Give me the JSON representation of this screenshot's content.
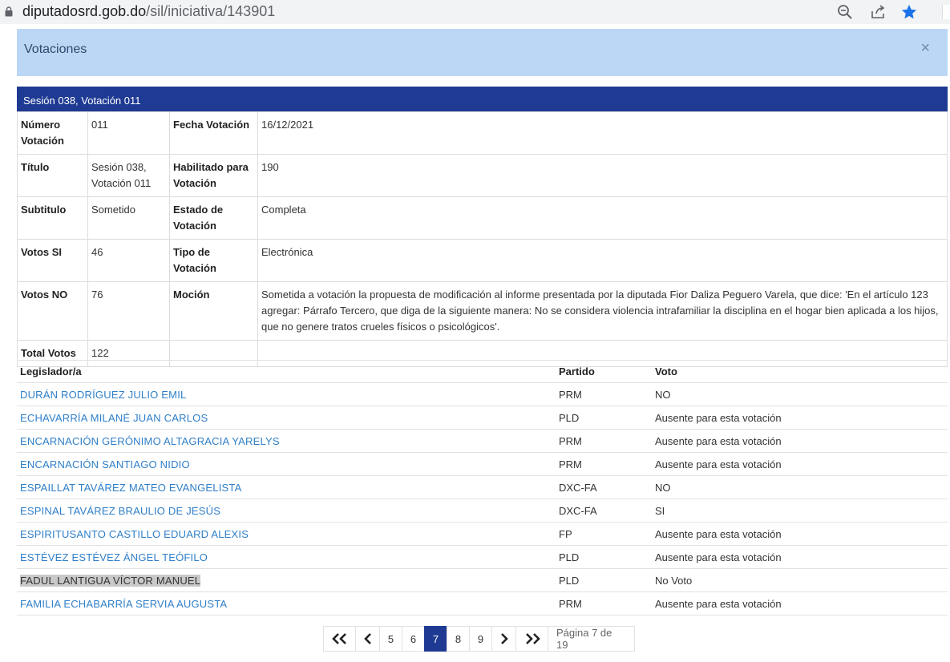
{
  "browser": {
    "url_host": "diputadosrd.gob.do",
    "url_path": "/sil/iniciativa/143901"
  },
  "modal": {
    "title": "Votaciones",
    "close_label": "×"
  },
  "session": {
    "title": "Sesión 038, Votación 011"
  },
  "details": {
    "numero_votacion_label": "Número Votación",
    "numero_votacion": "011",
    "fecha_votacion_label": "Fecha Votación",
    "fecha_votacion": "16/12/2021",
    "titulo_label": "Título",
    "titulo": "Sesión 038, Votación 011",
    "habilitado_label": "Habilitado para Votación",
    "habilitado": "190",
    "subtitulo_label": "Subtitulo",
    "subtitulo": "Sometido",
    "estado_label": "Estado de Votación",
    "estado": "Completa",
    "votos_si_label": "Votos SI",
    "votos_si": "46",
    "tipo_label": "Tipo de Votación",
    "tipo": "Electrónica",
    "votos_no_label": "Votos NO",
    "votos_no": "76",
    "mocion_label": "Moción",
    "mocion": "Sometida a votación la propuesta de modificación al informe presentada por la diputada Fior Daliza Peguero Varela, que dice: 'En el artículo 123 agregar: Párrafo Tercero, que diga de la siguiente manera: No se considera violencia intrafamiliar la disciplina en el hogar bien aplicada a los hijos, que no genere tratos crueles físicos o psicológicos'.",
    "total_votos_label": "Total Votos",
    "total_votos": "122"
  },
  "votes": {
    "headers": {
      "legislador": "Legislador/a",
      "partido": "Partido",
      "voto": "Voto"
    },
    "rows": [
      {
        "name": "DURÁN RODRÍGUEZ JULIO EMIL",
        "party": "PRM",
        "vote": "NO"
      },
      {
        "name": "ECHAVARRÍA MILANÉ JUAN CARLOS",
        "party": "PLD",
        "vote": "Ausente para esta votación"
      },
      {
        "name": "ENCARNACIÓN GERÓNIMO ALTAGRACIA YARELYS",
        "party": "PRM",
        "vote": "Ausente para esta votación"
      },
      {
        "name": "ENCARNACIÓN SANTIAGO NIDIO",
        "party": "PRM",
        "vote": "Ausente para esta votación"
      },
      {
        "name": "ESPAILLAT TAVÁREZ MATEO EVANGELISTA",
        "party": "DXC-FA",
        "vote": "NO"
      },
      {
        "name": "ESPINAL TAVÁREZ BRAULIO DE JESÚS",
        "party": "DXC-FA",
        "vote": "SI"
      },
      {
        "name": "ESPIRITUSANTO CASTILLO EDUARD ALEXIS",
        "party": "FP",
        "vote": "Ausente para esta votación"
      },
      {
        "name": "ESTÉVEZ ESTÉVEZ ÁNGEL TEÓFILO",
        "party": "PLD",
        "vote": "Ausente para esta votación"
      },
      {
        "name": "FADUL LANTIGUA VÍCTOR MANUEL",
        "party": "PLD",
        "vote": "No Voto"
      },
      {
        "name": "FAMILIA ECHABARRÍA SERVIA AUGUSTA",
        "party": "PRM",
        "vote": "Ausente para esta votación"
      }
    ]
  },
  "pagination": {
    "pages": [
      "5",
      "6",
      "7",
      "8",
      "9"
    ],
    "current": "7",
    "info": "Página 7 de 19"
  },
  "colors": {
    "session_bar": "#1f3a93",
    "modal_header": "#bcd6f6",
    "link": "#2f7fc9",
    "star": "#1a73e8"
  },
  "icons": [
    "lock-icon",
    "zoom-icon",
    "share-icon",
    "star-icon",
    "close-icon",
    "first-page-icon",
    "prev-page-icon",
    "next-page-icon",
    "last-page-icon"
  ]
}
